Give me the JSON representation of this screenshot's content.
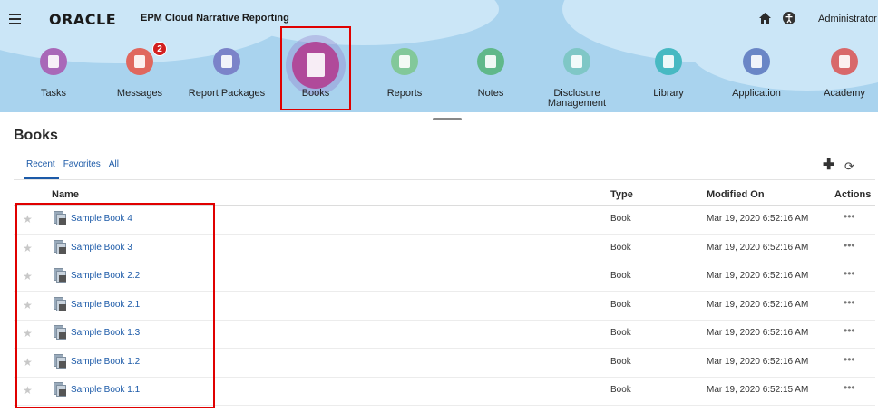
{
  "header": {
    "logo": "ORACLE",
    "logo_mark": "·",
    "app_title": "EPM Cloud Narrative Reporting",
    "user_label": "Administrator ▾"
  },
  "nav": [
    {
      "label": "Tasks",
      "color": "#a968b8",
      "icon": "tasks-icon"
    },
    {
      "label": "Messages",
      "color": "#e0675e",
      "icon": "messages-icon",
      "badge": "2"
    },
    {
      "label": "Report Packages",
      "color": "#7b83c9",
      "icon": "report-packages-icon"
    },
    {
      "label": "Books",
      "color": "#b04a9a",
      "icon": "books-icon"
    },
    {
      "label": "Reports",
      "color": "#82c89a",
      "icon": "reports-icon"
    },
    {
      "label": "Notes",
      "color": "#60b88a",
      "icon": "notes-icon"
    },
    {
      "label": "Disclosure\nManagement",
      "color": "#7fc7c6",
      "icon": "disclosure-management-icon"
    },
    {
      "label": "Library",
      "color": "#47b9c2",
      "icon": "library-icon"
    },
    {
      "label": "Application",
      "color": "#6a86c6",
      "icon": "application-icon"
    },
    {
      "label": "Academy",
      "color": "#d8686a",
      "icon": "academy-icon"
    }
  ],
  "page": {
    "title": "Books",
    "tabs": [
      "Recent",
      "Favorites",
      "All"
    ],
    "add_glyph": "✚",
    "refresh_glyph": "⟳"
  },
  "table": {
    "headers": {
      "name": "Name",
      "type": "Type",
      "modified": "Modified On",
      "actions": "Actions"
    },
    "star_glyph": "★",
    "actions_glyph": "•••",
    "rows": [
      {
        "name": "Sample Book 4",
        "type": "Book",
        "modified": "Mar 19, 2020 6:52:16 AM"
      },
      {
        "name": "Sample Book 3",
        "type": "Book",
        "modified": "Mar 19, 2020 6:52:16 AM"
      },
      {
        "name": "Sample Book 2.2",
        "type": "Book",
        "modified": "Mar 19, 2020 6:52:16 AM"
      },
      {
        "name": "Sample Book 2.1",
        "type": "Book",
        "modified": "Mar 19, 2020 6:52:16 AM"
      },
      {
        "name": "Sample Book 1.3",
        "type": "Book",
        "modified": "Mar 19, 2020 6:52:16 AM"
      },
      {
        "name": "Sample Book 1.2",
        "type": "Book",
        "modified": "Mar 19, 2020 6:52:16 AM"
      },
      {
        "name": "Sample Book 1.1",
        "type": "Book",
        "modified": "Mar 19, 2020 6:52:15 AM"
      }
    ]
  }
}
